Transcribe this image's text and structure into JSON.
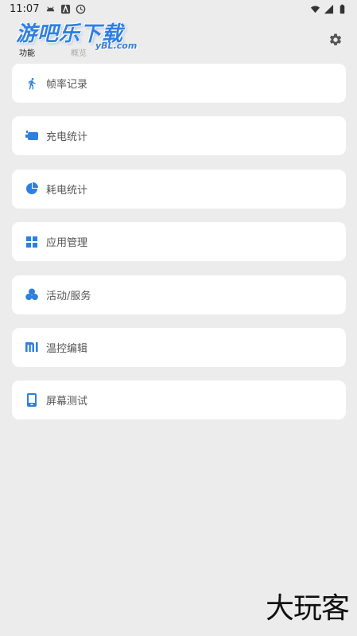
{
  "status_bar": {
    "time": "11:07",
    "left_icons": [
      "android-icon",
      "notification-a-icon",
      "clock-icon"
    ],
    "right_icons": [
      "wifi-icon",
      "signal-icon",
      "battery-icon"
    ]
  },
  "header": {
    "logo_text": "游吧乐下载",
    "logo_sub": "yBL.com",
    "tabs": [
      {
        "label": "功能",
        "active": true
      },
      {
        "label": "概览",
        "active": false
      }
    ],
    "settings_icon": "gear-icon"
  },
  "menu": {
    "items": [
      {
        "label": "帧率记录",
        "icon": "running-icon"
      },
      {
        "label": "充电统计",
        "icon": "charging-icon"
      },
      {
        "label": "耗电统计",
        "icon": "pie-chart-icon"
      },
      {
        "label": "应用管理",
        "icon": "grid-icon"
      },
      {
        "label": "活动/服务",
        "icon": "three-circles-icon"
      },
      {
        "label": "温控编辑",
        "icon": "mi-logo-icon"
      },
      {
        "label": "屏幕测试",
        "icon": "phone-screen-icon"
      }
    ]
  },
  "colors": {
    "accent": "#2f7fe0",
    "background": "#ececec",
    "card": "#ffffff"
  },
  "watermark": "大玩客"
}
